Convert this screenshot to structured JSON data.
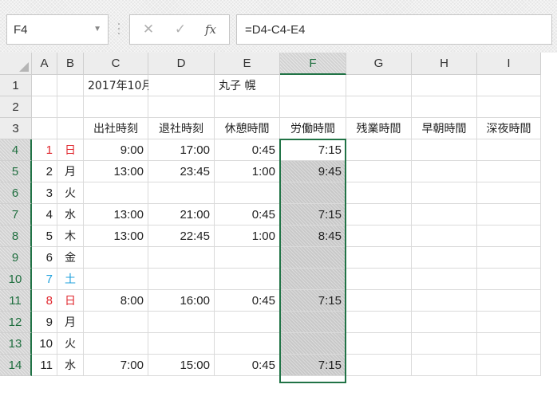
{
  "formula_bar": {
    "name_box": "F4",
    "name_box_dropdown_icon": "chevron-down-icon",
    "cancel_symbol": "✕",
    "enter_symbol": "✓",
    "fx_label": "fx",
    "formula": "=D4-C4-E4"
  },
  "columns": [
    "A",
    "B",
    "C",
    "D",
    "E",
    "F",
    "G",
    "H",
    "I"
  ],
  "selected_column": "F",
  "rows": [
    {
      "num": "1",
      "cells": {
        "C": "2017年10月",
        "E": "丸子 幌"
      }
    },
    {
      "num": "2",
      "cells": {}
    },
    {
      "num": "3",
      "cells": {
        "C": "出社時刻",
        "D": "退社時刻",
        "E": "休憩時間",
        "F": "労働時間",
        "G": "残業時間",
        "H": "早朝時間",
        "I": "深夜時間"
      }
    },
    {
      "num": "4",
      "cells": {
        "A": "1",
        "B": "日",
        "C": "9:00",
        "D": "17:00",
        "E": "0:45",
        "F": "7:15"
      },
      "color": "#e0262d"
    },
    {
      "num": "5",
      "cells": {
        "A": "2",
        "B": "月",
        "C": "13:00",
        "D": "23:45",
        "E": "1:00",
        "F": "9:45"
      }
    },
    {
      "num": "6",
      "cells": {
        "A": "3",
        "B": "火"
      }
    },
    {
      "num": "7",
      "cells": {
        "A": "4",
        "B": "水",
        "C": "13:00",
        "D": "21:00",
        "E": "0:45",
        "F": "7:15"
      }
    },
    {
      "num": "8",
      "cells": {
        "A": "5",
        "B": "木",
        "C": "13:00",
        "D": "22:45",
        "E": "1:00",
        "F": "8:45"
      }
    },
    {
      "num": "9",
      "cells": {
        "A": "6",
        "B": "金"
      }
    },
    {
      "num": "10",
      "cells": {
        "A": "7",
        "B": "土"
      },
      "color": "#1ea0dc"
    },
    {
      "num": "11",
      "cells": {
        "A": "8",
        "B": "日",
        "C": "8:00",
        "D": "16:00",
        "E": "0:45",
        "F": "7:15"
      },
      "color": "#e0262d"
    },
    {
      "num": "12",
      "cells": {
        "A": "9",
        "B": "月"
      }
    },
    {
      "num": "13",
      "cells": {
        "A": "10",
        "B": "火"
      }
    },
    {
      "num": "14",
      "cells": {
        "A": "11",
        "B": "水",
        "C": "7:00",
        "D": "15:00",
        "E": "0:45",
        "F": "7:15"
      }
    }
  ],
  "selection": {
    "active_cell": "F4",
    "range": "F4:F14"
  },
  "colors": {
    "accent": "#217346",
    "sunday": "#e0262d",
    "saturday": "#1ea0dc"
  }
}
